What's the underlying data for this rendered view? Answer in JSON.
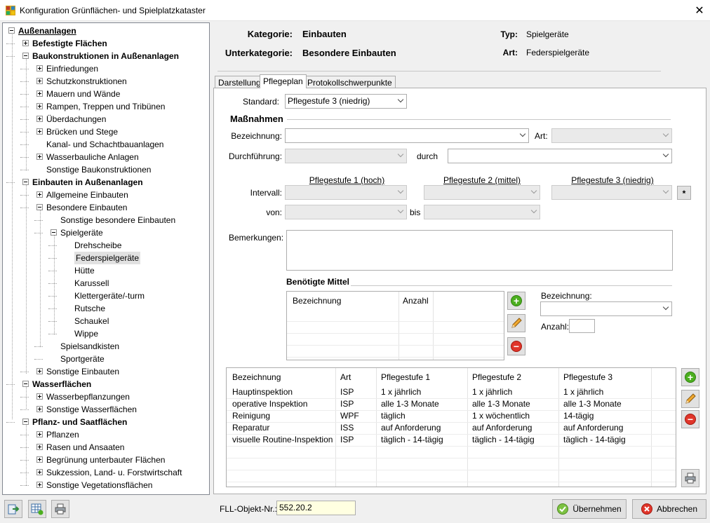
{
  "window": {
    "title": "Konfiguration Grünflächen- und Spielplatzkataster",
    "close": "✕"
  },
  "tree": {
    "nodes": [
      {
        "label": "Außenanlagen"
      },
      {
        "label": "Befestigte Flächen"
      },
      {
        "label": "Baukonstruktionen in Außenanlagen"
      },
      {
        "label": "Einfriedungen"
      },
      {
        "label": "Schutzkonstruktionen"
      },
      {
        "label": "Mauern und Wände"
      },
      {
        "label": "Rampen, Treppen und Tribünen"
      },
      {
        "label": "Überdachungen"
      },
      {
        "label": "Brücken und Stege"
      },
      {
        "label": "Kanal- und Schachtbauanlagen"
      },
      {
        "label": "Wasserbauliche Anlagen"
      },
      {
        "label": "Sonstige Baukonstruktionen"
      },
      {
        "label": "Einbauten in Außenanlagen"
      },
      {
        "label": "Allgemeine Einbauten"
      },
      {
        "label": "Besondere Einbauten"
      },
      {
        "label": "Sonstige besondere Einbauten"
      },
      {
        "label": "Spielgeräte"
      },
      {
        "label": "Drehscheibe"
      },
      {
        "label": "Federspielgeräte"
      },
      {
        "label": "Hütte"
      },
      {
        "label": "Karussell"
      },
      {
        "label": "Klettergeräte/-turm"
      },
      {
        "label": "Rutsche"
      },
      {
        "label": "Schaukel"
      },
      {
        "label": "Wippe"
      },
      {
        "label": "Spielsandkisten"
      },
      {
        "label": "Sportgeräte"
      },
      {
        "label": "Sonstige Einbauten"
      },
      {
        "label": "Wasserflächen"
      },
      {
        "label": "Wasserbepflanzungen"
      },
      {
        "label": "Sonstige Wasserflächen"
      },
      {
        "label": "Pflanz- und Saatflächen"
      },
      {
        "label": "Pflanzen"
      },
      {
        "label": "Rasen und Ansaaten"
      },
      {
        "label": "Begrünung unterbauter Flächen"
      },
      {
        "label": "Sukzession, Land- u. Forstwirtschaft"
      },
      {
        "label": "Sonstige Vegetationsflächen"
      }
    ]
  },
  "header": {
    "kategorie_label": "Kategorie:",
    "kategorie_value": "Einbauten",
    "typ_label": "Typ:",
    "typ_value": "Spielgeräte",
    "unterkategorie_label": "Unterkategorie:",
    "unterkategorie_value": "Besondere Einbauten",
    "art_label": "Art:",
    "art_value": "Federspielgeräte"
  },
  "tabs": [
    {
      "label": "Darstellung"
    },
    {
      "label": "Pflegeplan"
    },
    {
      "label": "Protokollschwerpunkte"
    }
  ],
  "form": {
    "standard_label": "Standard:",
    "standard_value": "Pflegestufe 3 (niedrig)",
    "massnahmen_title": "Maßnahmen",
    "bezeichnung_label": "Bezeichnung:",
    "art_label": "Art:",
    "durchfuehrung_label": "Durchführung:",
    "durch_label": "durch",
    "stufe1_head": "Pflegestufe 1 (hoch)",
    "stufe2_head": "Pflegestufe 2 (mittel)",
    "stufe3_head": "Pflegestufe 3 (niedrig)",
    "intervall_label": "Intervall:",
    "asterisk": "*",
    "von_label": "von:",
    "bis_label": "bis",
    "bemerkungen_label": "Bemerkungen:",
    "mittel_title": "Benötigte Mittel",
    "mittel_columns": [
      "Bezeichnung",
      "Anzahl"
    ],
    "mittel_bez_label": "Bezeichnung:",
    "mittel_anzahl_label": "Anzahl:"
  },
  "table": {
    "columns": [
      "Bezeichnung",
      "Art",
      "Pflegestufe 1",
      "Pflegestufe 2",
      "Pflegestufe 3"
    ],
    "rows": [
      [
        "Hauptinspektion",
        "ISP",
        "1 x jährlich",
        "1 x jährlich",
        "1 x jährlich"
      ],
      [
        "operative Inspektion",
        "ISP",
        "alle 1-3 Monate",
        "alle 1-3 Monate",
        "alle 1-3 Monate"
      ],
      [
        "Reinigung",
        "WPF",
        "täglich",
        "1 x wöchentlich",
        "14-tägig"
      ],
      [
        "Reparatur",
        "ISS",
        "auf Anforderung",
        "auf Anforderung",
        "auf Anforderung"
      ],
      [
        "visuelle Routine-Inspektion",
        "ISP",
        "täglich - 14-tägig",
        "täglich - 14-tägig",
        "täglich - 14-tägig"
      ]
    ]
  },
  "footer": {
    "fll_label": "FLL-Objekt-Nr.:",
    "fll_value": "552.20.2",
    "ok_label": "Übernehmen",
    "cancel_label": "Abbrechen"
  },
  "colors": {
    "add": "#4caf1f",
    "remove": "#e0352a",
    "fll_bg": "#ffffe1"
  }
}
